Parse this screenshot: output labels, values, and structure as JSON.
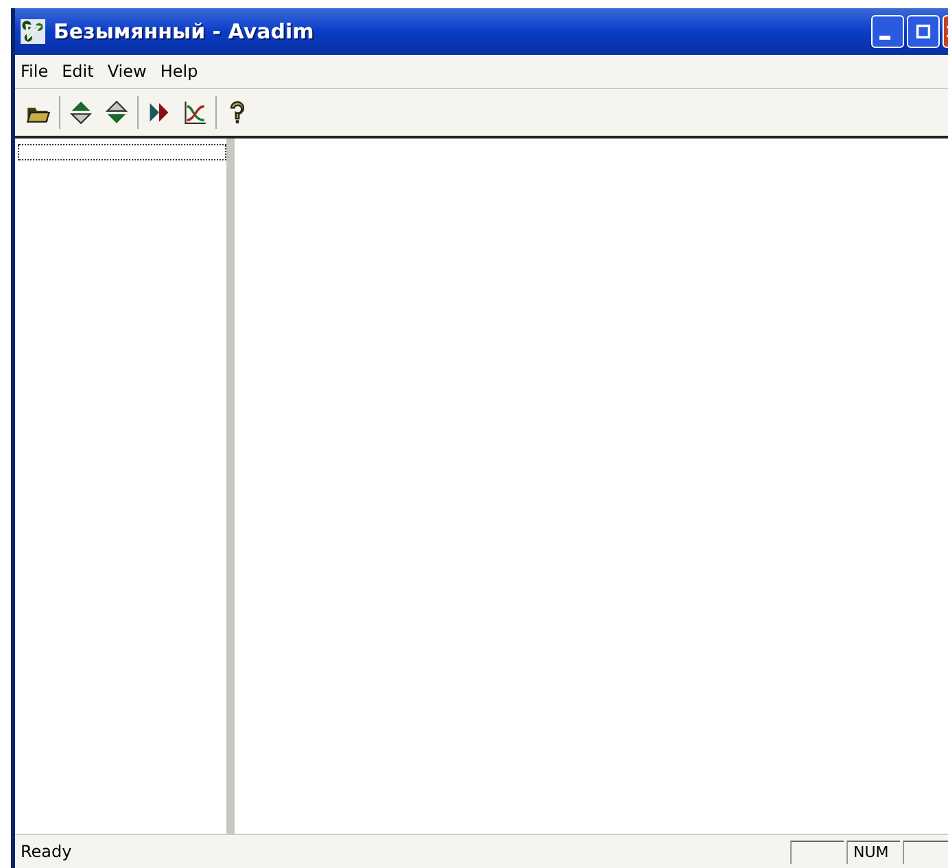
{
  "window": {
    "title": "Безымянный - Avadim"
  },
  "menu": [
    "File",
    "Edit",
    "View",
    "Help"
  ],
  "status_bar": {
    "text": "Ready",
    "indicator": "NUM"
  }
}
